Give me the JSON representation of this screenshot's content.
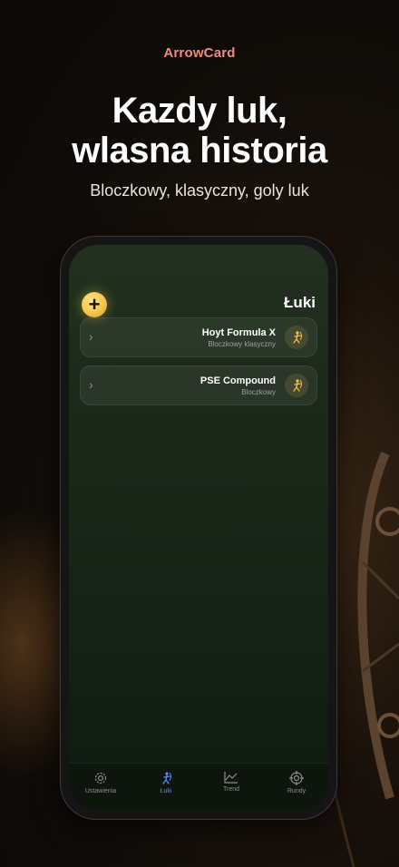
{
  "brand": "ArrowCard",
  "headline": {
    "line1": "Kazdy luk,",
    "line2": "wlasna historia"
  },
  "subhead": "Bloczkowy, klasyczny, goly luk",
  "colors": {
    "brand": "#f08a80",
    "accent_gold": "#f2c54a",
    "tab_active": "#5b8cff"
  },
  "screen": {
    "title": "Łuki",
    "add_icon": "plus-icon",
    "bows": [
      {
        "name": "Hoyt Formula X",
        "type": "Bloczkowy klasyczny",
        "icon": "archer-icon"
      },
      {
        "name": "PSE Compound",
        "type": "Bloczkowy",
        "icon": "archer-icon"
      }
    ]
  },
  "tabs": [
    {
      "label": "Ustawienia",
      "icon": "gear-icon"
    },
    {
      "label": "Łuki",
      "icon": "archer-icon",
      "active": true
    },
    {
      "label": "Trend",
      "icon": "chart-icon"
    },
    {
      "label": "Rundy",
      "icon": "target-icon"
    }
  ]
}
